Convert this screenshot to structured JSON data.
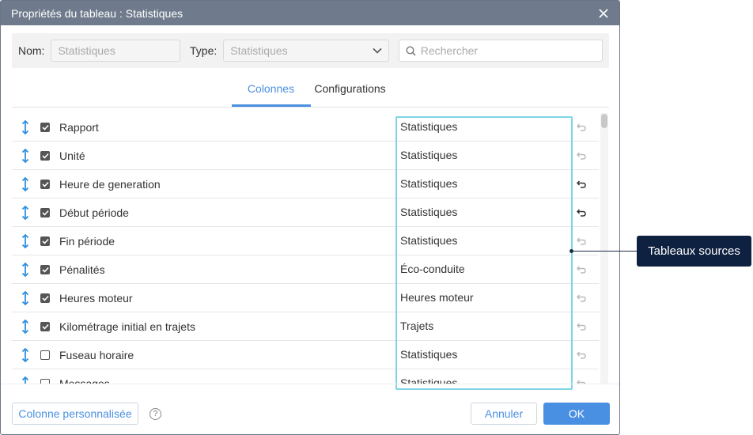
{
  "dialog": {
    "title": "Propriétés du tableau : Statistiques"
  },
  "filters": {
    "name_label": "Nom:",
    "name_placeholder": "Statistiques",
    "type_label": "Type:",
    "type_value": "Statistiques",
    "search_placeholder": "Rechercher"
  },
  "tabs": [
    {
      "label": "Colonnes",
      "active": true
    },
    {
      "label": "Configurations",
      "active": false
    }
  ],
  "rows": [
    {
      "name": "Rapport",
      "checked": true,
      "source": "Statistiques",
      "undo_active": false
    },
    {
      "name": "Unité",
      "checked": true,
      "source": "Statistiques",
      "undo_active": false
    },
    {
      "name": "Heure de generation",
      "checked": true,
      "source": "Statistiques",
      "undo_active": true
    },
    {
      "name": "Début période",
      "checked": true,
      "source": "Statistiques",
      "undo_active": true
    },
    {
      "name": "Fin période",
      "checked": true,
      "source": "Statistiques",
      "undo_active": false
    },
    {
      "name": "Pénalités",
      "checked": true,
      "source": "Éco-conduite",
      "undo_active": false
    },
    {
      "name": "Heures moteur",
      "checked": true,
      "source": "Heures moteur",
      "undo_active": false
    },
    {
      "name": "Kilométrage initial en trajets",
      "checked": true,
      "source": "Trajets",
      "undo_active": false
    },
    {
      "name": "Fuseau horaire",
      "checked": false,
      "source": "Statistiques",
      "undo_active": false
    },
    {
      "name": "Messages",
      "checked": false,
      "source": "Statistiques",
      "undo_active": false
    }
  ],
  "footer": {
    "custom_column_label": "Colonne personnalisée",
    "help_label": "?",
    "cancel_label": "Annuler",
    "ok_label": "OK"
  },
  "callout": {
    "label": "Tableaux sources"
  },
  "colors": {
    "accent": "#4a90e2",
    "titlebar": "#6f7b8c",
    "highlight": "#7fd3e6",
    "callout_bg": "#0f2140"
  }
}
